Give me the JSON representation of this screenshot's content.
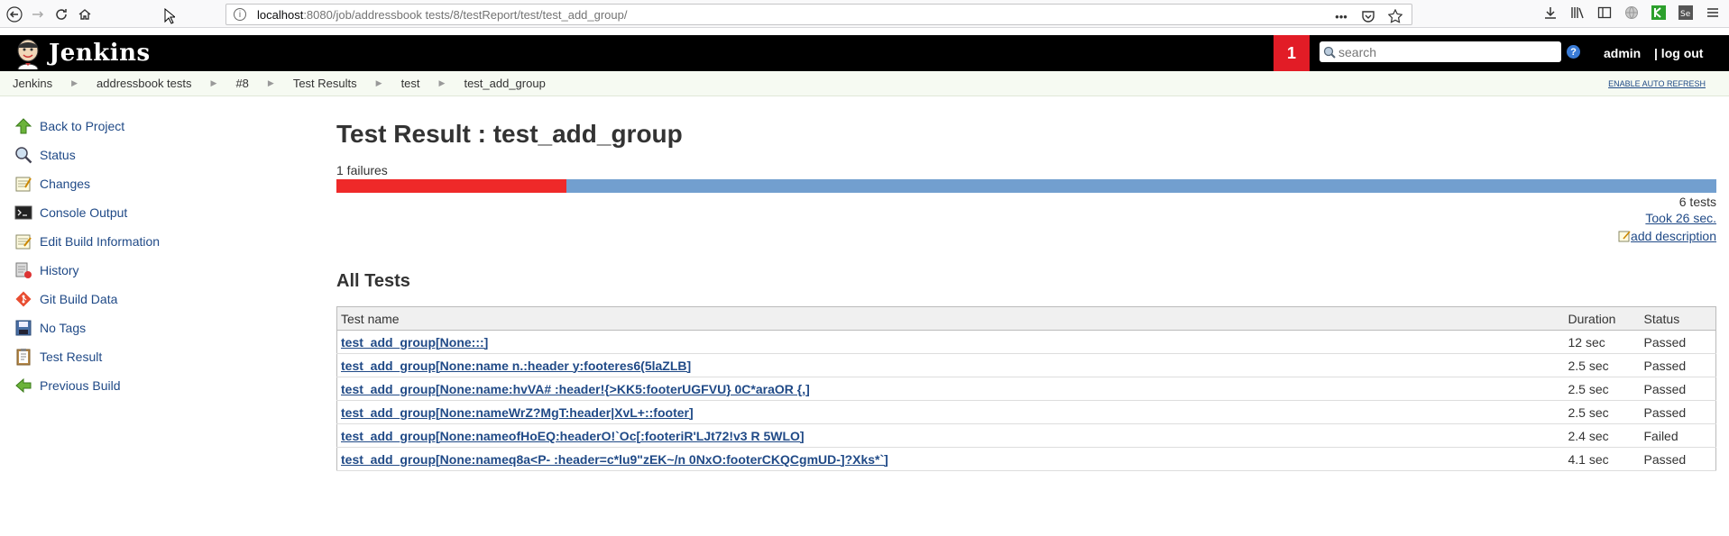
{
  "browser": {
    "url_host": "localhost",
    "url_rest": ":8080/job/addressbook tests/8/testReport/test/test_add_group/"
  },
  "header": {
    "app_name": "Jenkins",
    "notification_count": "1",
    "search_placeholder": "search",
    "help": "?",
    "user": "admin",
    "logout": "| log out"
  },
  "breadcrumb": {
    "items": [
      "Jenkins",
      "addressbook tests",
      "#8",
      "Test Results",
      "test",
      "test_add_group"
    ],
    "auto_refresh": "ENABLE AUTO REFRESH"
  },
  "sidebar": {
    "items": [
      {
        "label": "Back to Project",
        "icon": "up-arrow-icon"
      },
      {
        "label": "Status",
        "icon": "magnifier-icon"
      },
      {
        "label": "Changes",
        "icon": "notepad-icon"
      },
      {
        "label": "Console Output",
        "icon": "terminal-icon"
      },
      {
        "label": "Edit Build Information",
        "icon": "notepad-edit-icon"
      },
      {
        "label": "History",
        "icon": "history-icon"
      },
      {
        "label": "Git Build Data",
        "icon": "git-icon"
      },
      {
        "label": "No Tags",
        "icon": "save-icon"
      },
      {
        "label": "Test Result",
        "icon": "clipboard-icon"
      },
      {
        "label": "Previous Build",
        "icon": "left-arrow-icon"
      }
    ]
  },
  "main": {
    "title": "Test Result : test_add_group",
    "failures": "1 failures",
    "failure_fraction": 0.1667,
    "tests_count": "6 tests",
    "took": "Took 26 sec.",
    "add_description": "add description",
    "all_tests_heading": "All Tests",
    "table": {
      "headers": [
        "Test name",
        "Duration",
        "Status"
      ],
      "rows": [
        {
          "name": "test_add_group[None:::]",
          "duration": "12 sec",
          "status": "Passed"
        },
        {
          "name": "test_add_group[None:name n.:header y:footeres6(5laZLB]",
          "duration": "2.5 sec",
          "status": "Passed"
        },
        {
          "name": "test_add_group[None:name:hvVA# :header!{>KK5:footerUGFVU} 0C*araOR {,]",
          "duration": "2.5 sec",
          "status": "Passed"
        },
        {
          "name": "test_add_group[None:nameWrZ?MgT:header|XvL+::footer]",
          "duration": "2.5 sec",
          "status": "Passed"
        },
        {
          "name": "test_add_group[None:nameofHoEQ:headerO!`Oc[:footeriR'LJt72!v3 R 5WLO]",
          "duration": "2.4 sec",
          "status": "Failed"
        },
        {
          "name": "test_add_group[None:nameq8a<P- :header=c*lu9\"zEK~/n 0NxO:footerCKQCgmUD-]?Xks*`]",
          "duration": "4.1 sec",
          "status": "Passed"
        }
      ]
    }
  },
  "colors": {
    "fail": "#ef2929",
    "pass": "#729fcf",
    "link": "#204a87",
    "failed_text": "#cc0000"
  }
}
